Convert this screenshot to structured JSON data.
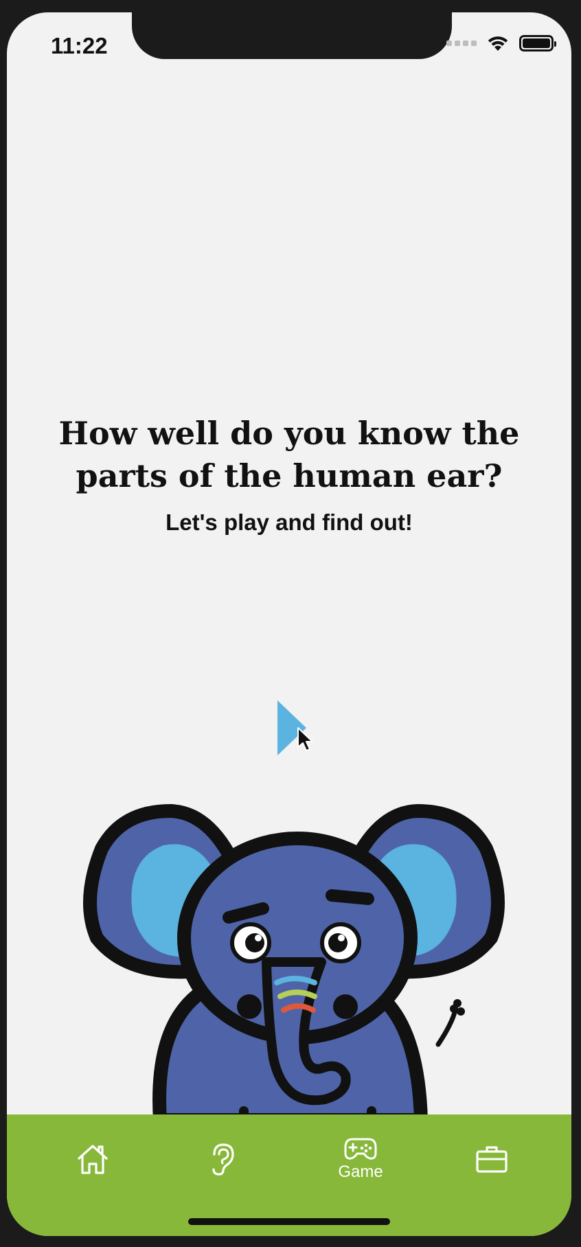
{
  "status_bar": {
    "time": "11:22"
  },
  "content": {
    "title_line1": "How well do you know the",
    "title_line2": "parts of the human ear?",
    "subtitle": "Let's play and find out!"
  },
  "play_button": {
    "icon": "play-icon",
    "color": "#5bb3df"
  },
  "illustration": {
    "name": "elephant-mascot",
    "body_color": "#4f64a8",
    "ear_inner_color": "#5bb3df",
    "trunk_stripes": [
      "#5bb3df",
      "#b5cf5a",
      "#e0583a"
    ]
  },
  "tab_bar": {
    "background": "#88b83a",
    "tabs": [
      {
        "icon": "home-icon",
        "label": ""
      },
      {
        "icon": "ear-icon",
        "label": ""
      },
      {
        "icon": "gamepad-icon",
        "label": "Game",
        "active": true
      },
      {
        "icon": "briefcase-icon",
        "label": ""
      }
    ]
  }
}
